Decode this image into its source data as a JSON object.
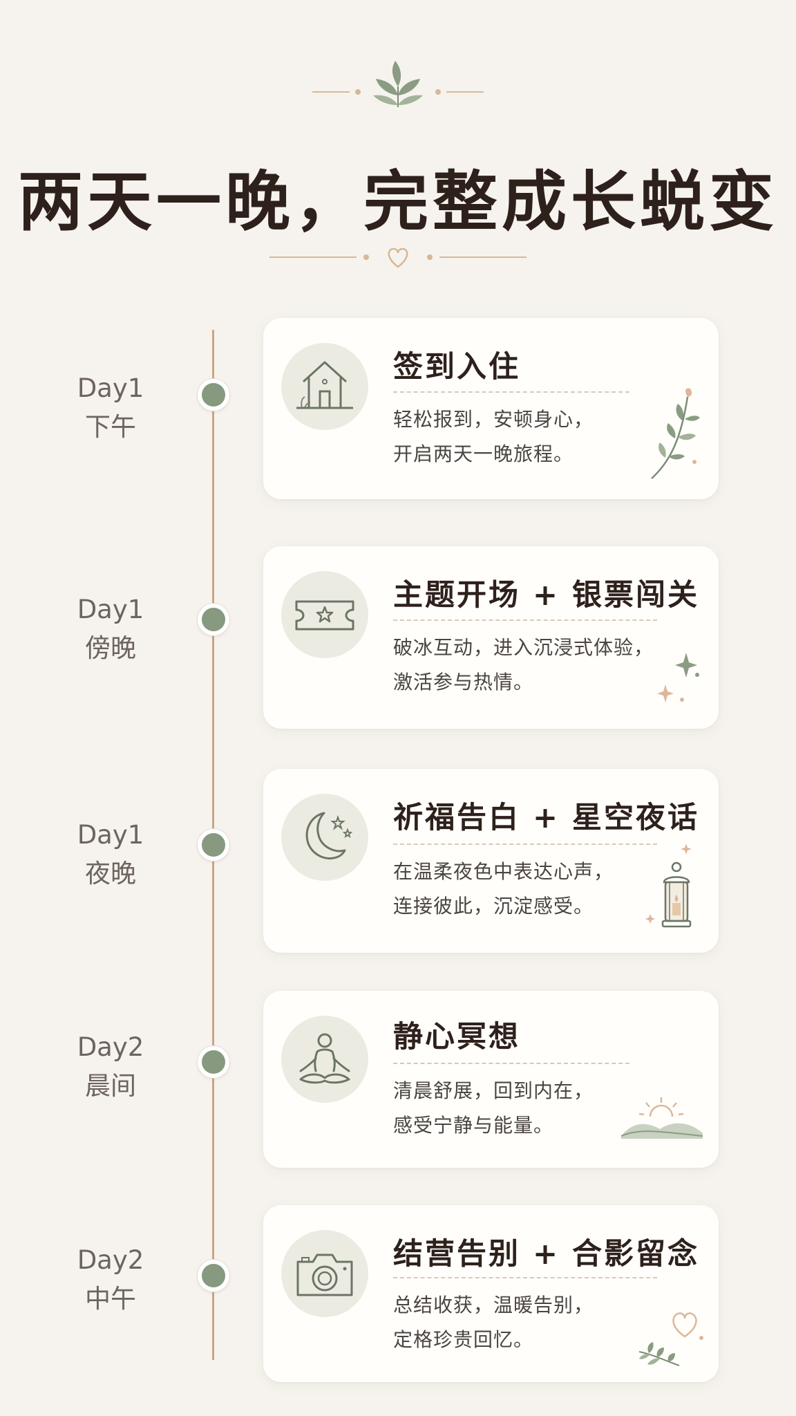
{
  "header": {
    "title": "两天一晚，完整成长蜕变",
    "top_ornament_icon": "leaf-sprig-icon",
    "divider_icon": "heart-outline-icon"
  },
  "colors": {
    "background": "#f6f3ee",
    "title": "#2e211c",
    "timeline_line": "#c9a682",
    "dot": "#87997f",
    "sage": "#7a8c72",
    "accent_gold": "#d8b796"
  },
  "timeline": [
    {
      "day": "Day1",
      "period": "下午",
      "icon": "house-icon",
      "title": "签到入住",
      "desc_line1": "轻松报到，安顿身心，",
      "desc_line2": "开启两天一晚旅程。",
      "decoration": "leaf-branch-icon"
    },
    {
      "day": "Day1",
      "period": "傍晚",
      "icon": "ticket-star-icon",
      "title": "主题开场 + 银票闯关",
      "desc_line1": "破冰互动，进入沉浸式体验，",
      "desc_line2": "激活参与热情。",
      "decoration": "sparkles-icon"
    },
    {
      "day": "Day1",
      "period": "夜晚",
      "icon": "moon-stars-icon",
      "title": "祈福告白 + 星空夜话",
      "desc_line1": "在温柔夜色中表达心声，",
      "desc_line2": "连接彼此，沉淀感受。",
      "decoration": "lantern-icon"
    },
    {
      "day": "Day2",
      "period": "晨间",
      "icon": "meditation-icon",
      "title": "静心冥想",
      "desc_line1": "清晨舒展，回到内在，",
      "desc_line2": "感受宁静与能量。",
      "decoration": "sunrise-hills-icon"
    },
    {
      "day": "Day2",
      "period": "中午",
      "icon": "camera-icon",
      "title": "结营告别 + 合影留念",
      "desc_line1": "总结收获，温暖告别，",
      "desc_line2": "定格珍贵回忆。",
      "decoration": "heart-leaves-icon"
    }
  ]
}
